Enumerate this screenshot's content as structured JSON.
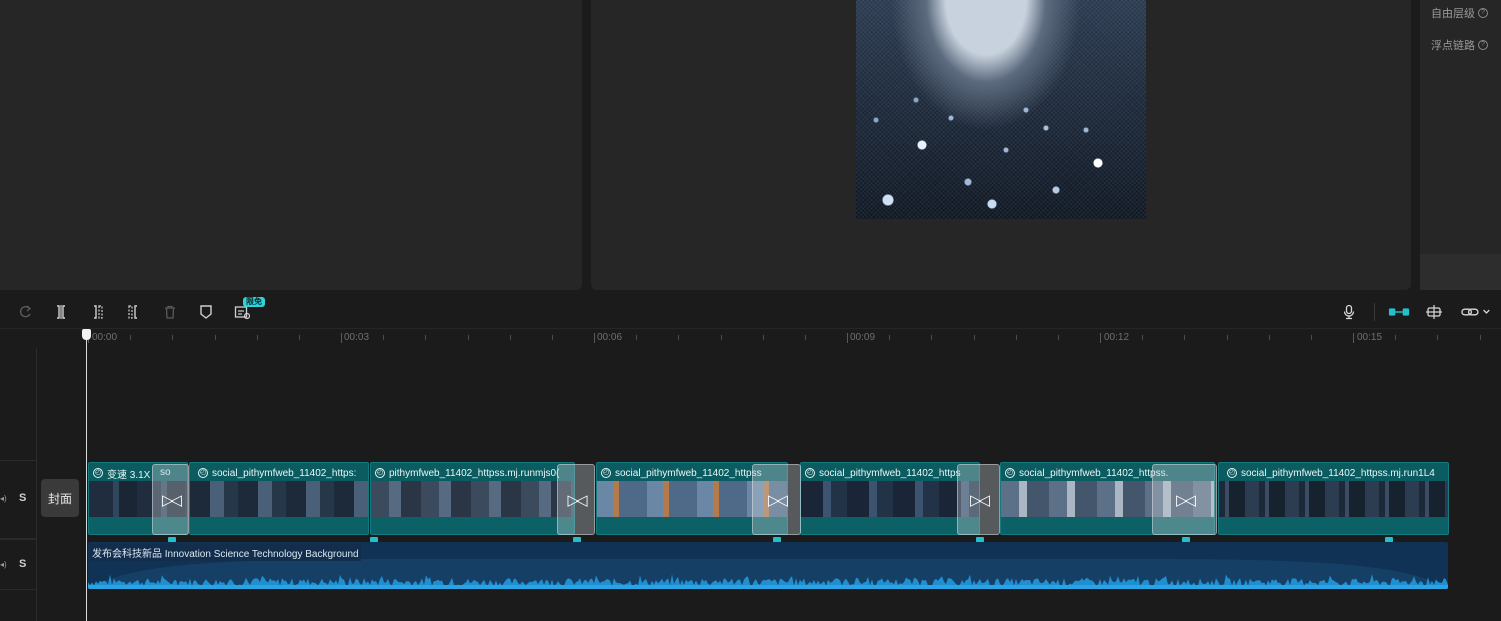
{
  "right_panel": {
    "items": [
      {
        "label": "自由层级",
        "help": "?"
      },
      {
        "label": "浮点链路",
        "help": "?"
      }
    ]
  },
  "toolbar": {
    "badge": "限免",
    "buttons": [
      "redo-icon",
      "split-icon",
      "split-left-icon",
      "split-right-icon",
      "delete-icon",
      "marker-icon",
      "ai-caption-icon"
    ],
    "right_buttons": [
      "microphone-icon",
      "magnet-icon",
      "preview-axis-icon",
      "link-icon"
    ]
  },
  "ruler": {
    "labels": [
      "00:00",
      "00:03",
      "00:06",
      "00:09",
      "00:12",
      "00:15"
    ]
  },
  "tracks": {
    "cover_label": "封面",
    "video_solo": "S",
    "audio_solo": "S"
  },
  "video_clips": [
    {
      "title": "变速 3.1X",
      "speed_icon": "speed-icon"
    },
    {
      "title": "so",
      "speed_icon": ""
    },
    {
      "title": "social_pithymfweb_11402_https:",
      "speed_icon": "speed-icon"
    },
    {
      "title": "pithymfweb_11402_httpss.mj.runmjs0(",
      "speed_icon": "speed-icon"
    },
    {
      "title": "social_pithymfweb_11402_httpss",
      "speed_icon": "speed-icon"
    },
    {
      "title": "social_pithymfweb_11402_https",
      "speed_icon": "speed-icon"
    },
    {
      "title": "social_pithymfweb_11402_httpss.",
      "speed_icon": "speed-icon"
    },
    {
      "title": "social_pithymfweb_11402_httpss.mj.run1L4",
      "speed_icon": "speed-icon"
    }
  ],
  "audio_clip": {
    "title": "发布会科技新品  Innovation Science Technology Background"
  },
  "colors": {
    "accent": "#24c0c9",
    "video_clip": "#0b5c61",
    "audio_clip": "#0f3255"
  }
}
